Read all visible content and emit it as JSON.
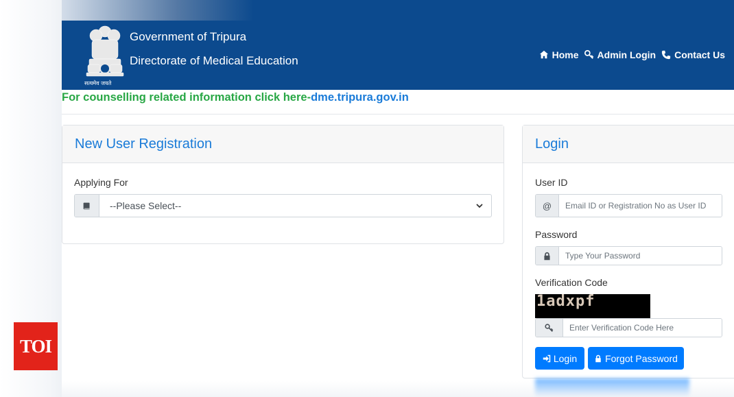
{
  "header": {
    "emblem_motto": "सत्यमेव जयते",
    "gov_title": "Government of Tripura",
    "dept_title": "Directorate of Medical Education",
    "nav": [
      {
        "label": "Home",
        "icon": "home-icon"
      },
      {
        "label": "Admin Login",
        "icon": "key-icon"
      },
      {
        "label": "Contact Us",
        "icon": "phone-icon"
      }
    ]
  },
  "notice": {
    "text": "For counselling related information click here-",
    "link": "dme.tripura.gov.in"
  },
  "registration": {
    "title": "New User Registration",
    "applying_label": "Applying For",
    "select_value": "--Please Select--"
  },
  "login": {
    "title": "Login",
    "userid_label": "User ID",
    "userid_addon": "@",
    "userid_placeholder": "Email ID or Registration No as User ID",
    "password_label": "Password",
    "password_placeholder": "Type Your Password",
    "verification_label": "Verification Code",
    "captcha_text": "1adxpf",
    "verification_placeholder": "Enter Verification Code Here",
    "login_button": "Login",
    "forgot_button": "Forgot Password"
  },
  "watermark": "TOI",
  "colors": {
    "header_bg": "#0c4a8e",
    "accent": "#007bff",
    "title_blue": "#1a7bd8",
    "notice_green": "#28a745",
    "watermark_red": "#e2231a"
  }
}
